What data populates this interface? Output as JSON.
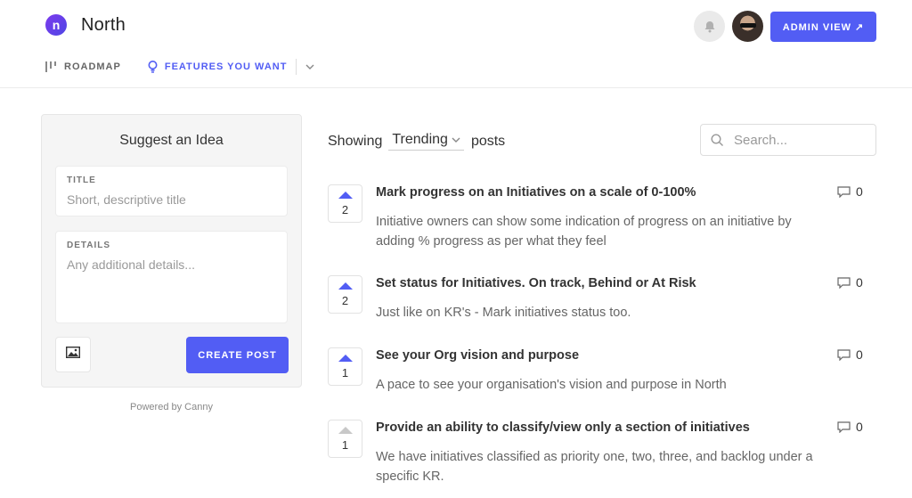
{
  "brand": {
    "logo_letter": "n",
    "name": "North"
  },
  "header": {
    "admin_button": "ADMIN VIEW ↗"
  },
  "nav": {
    "roadmap": "ROADMAP",
    "features": "FEATURES YOU WANT"
  },
  "suggest": {
    "title": "Suggest an Idea",
    "title_label": "TITLE",
    "title_placeholder": "Short, descriptive title",
    "details_label": "DETAILS",
    "details_placeholder": "Any additional details...",
    "create_button": "CREATE POST"
  },
  "powered_by": "Powered by Canny",
  "filter": {
    "showing": "Showing",
    "sort": "Trending",
    "posts": "posts"
  },
  "search": {
    "placeholder": "Search..."
  },
  "posts": [
    {
      "votes": "2",
      "title": "Mark progress on an Initiatives on a scale of 0-100%",
      "description": "Initiative owners can show some indication of progress on an initiative by adding % progress as per what they feel",
      "comments": "0"
    },
    {
      "votes": "2",
      "title": "Set status for Initiatives. On track, Behind or At Risk",
      "description": "Just like on KR's - Mark initiatives status too.",
      "comments": "0"
    },
    {
      "votes": "1",
      "title": "See your Org vision and purpose",
      "description": "A pace to see your organisation's vision and purpose in North",
      "comments": "0"
    },
    {
      "votes": "1",
      "title": "Provide an ability to classify/view only a section of initiatives",
      "description": "We have initiatives classified as priority one, two, three, and backlog under a specific KR.",
      "comments": "0"
    }
  ],
  "colors": {
    "accent": "#525df4",
    "logo": "#6d3ff0"
  }
}
